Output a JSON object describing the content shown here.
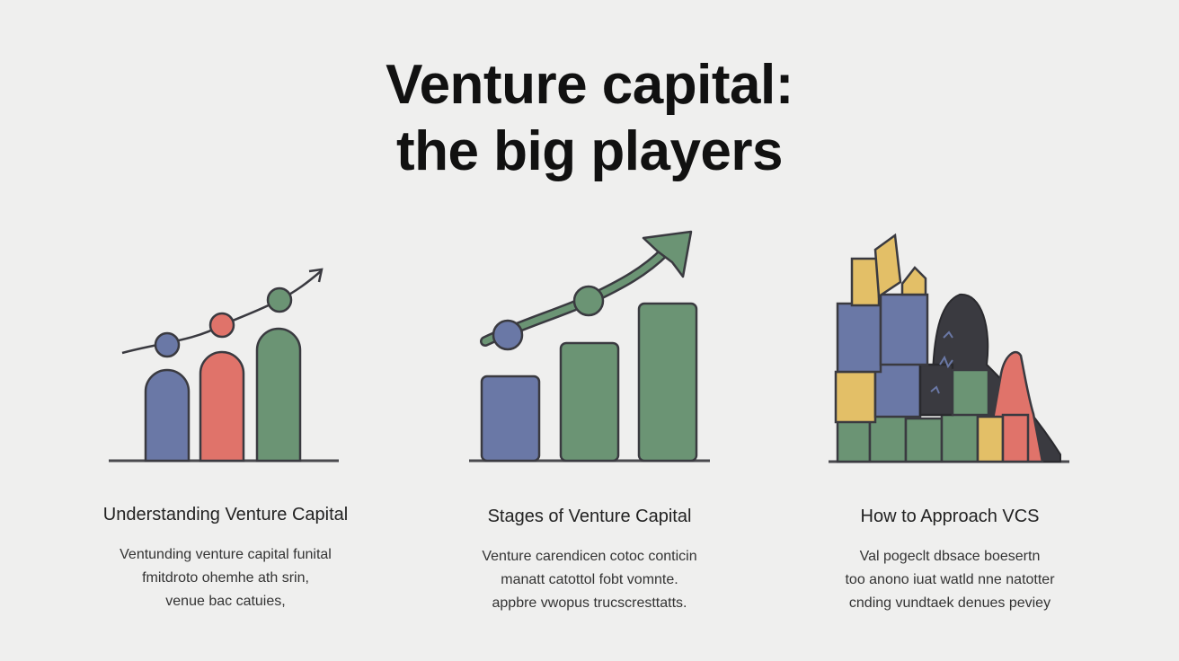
{
  "title": {
    "line1": "Venture capital:",
    "line2": "the big players"
  },
  "colors": {
    "blue": "#6a78a6",
    "red": "#e0736a",
    "green": "#6b9474",
    "yellow": "#e3bf67",
    "dark": "#3a3a40",
    "line": "#4a4a4e"
  },
  "columns": [
    {
      "heading": "Understanding Venture Capital",
      "lines": [
        "Ventunding venture capital  funital",
        "fmitdroto ohemhe  ath srin,",
        "venue bac catuies,"
      ],
      "icon": "rising-bars-trend-icon"
    },
    {
      "heading": "Stages of Venture Capital",
      "lines": [
        "Venture carendicen cotoc conticin",
        "manatt catottol fobt vomnte.",
        "appbre vwopus trucscresttatts."
      ],
      "icon": "growth-bars-arrow-icon"
    },
    {
      "heading": "How to Approach VCS",
      "lines": [
        "Val pogeclt dbsace boesertn",
        "too anono iuat watld nne natotter",
        "cnding vundtaek denues peviey"
      ],
      "icon": "stacked-blocks-icon"
    }
  ]
}
